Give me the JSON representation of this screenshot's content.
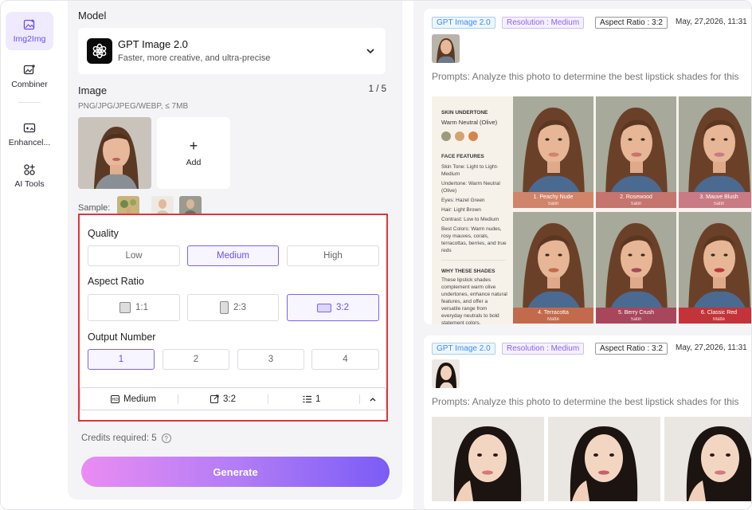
{
  "sidebar": {
    "items": [
      {
        "label": "Img2Img",
        "icon": "image-sparkle-icon",
        "active": true
      },
      {
        "label": "Combiner",
        "icon": "combine-images-icon",
        "active": false
      },
      {
        "label": "Enhancel...",
        "icon": "enhance-image-icon",
        "active": false
      },
      {
        "label": "AI Tools",
        "icon": "ai-tools-grid-icon",
        "active": false
      }
    ]
  },
  "panel": {
    "model_label": "Model",
    "model": {
      "name": "GPT Image 2.0",
      "description": "Faster, more creative, and ultra-precise",
      "icon": "openai-logo-icon"
    },
    "image_label": "Image",
    "image_count": "1 / 5",
    "image_hint": "PNG/JPG/JPEG/WEBP, ≤ 7MB",
    "add_label": "Add",
    "sample_label": "Sample:"
  },
  "settings": {
    "quality_label": "Quality",
    "quality_options": [
      "Low",
      "Medium",
      "High"
    ],
    "quality_selected": "Medium",
    "aspect_label": "Aspect Ratio",
    "aspect_options": [
      "1:1",
      "2:3",
      "3:2"
    ],
    "aspect_selected": "3:2",
    "output_label": "Output Number",
    "output_options": [
      "1",
      "2",
      "3",
      "4"
    ],
    "output_selected": "1",
    "summary": {
      "quality": "Medium",
      "aspect": "3:2",
      "output": "1"
    }
  },
  "credits_text": "Credits required: 5",
  "credits_help": "?",
  "generate_label": "Generate",
  "results": [
    {
      "model_tag": "GPT Image 2.0",
      "resolution_tag": "Resolution : Medium",
      "aspect_tag": "Aspect Ratio : 3:2",
      "date": "May, 27,2026, 11:31",
      "prompt": "Prompts: Analyze this photo to determine the best lipstick shades for this",
      "panel": {
        "skin_undertone_title": "SKIN UNDERTONE",
        "skin_undertone_value": "Warm Neutral (Olive)",
        "swatch_colors": [
          "#9a9c7a",
          "#d3a472",
          "#d7834e"
        ],
        "face_features_title": "FACE FEATURES",
        "features": [
          "Skin Tone: Light to Light-Medium",
          "Undertone: Warm Neutral (Olive)",
          "Eyes: Hazel Green",
          "Hair: Light Brown",
          "Contrast: Low to Medium",
          "Best Colors: Warm nudes, rosy mauves, corals, terracottas, berries, and true reds"
        ],
        "why_title": "WHY THESE SHADES",
        "why_text": "These lipstick shades complement warm olive undertones, enhance natural features, and offer a versatile range from everyday neutrals to bold statement colors."
      },
      "shades": [
        {
          "name": "1. Peachy Nude",
          "finish": "Satin",
          "color": "#d1846a"
        },
        {
          "name": "2. Rosewood",
          "finish": "Satin",
          "color": "#c5746e"
        },
        {
          "name": "3. Mauve Blush",
          "finish": "Satin",
          "color": "#c97a84"
        },
        {
          "name": "4. Terracotta",
          "finish": "Matte",
          "color": "#c36a4c"
        },
        {
          "name": "5. Berry Crush",
          "finish": "Satin",
          "color": "#a8465c"
        },
        {
          "name": "6. Classic Red",
          "finish": "Matte",
          "color": "#c2343a"
        }
      ]
    },
    {
      "model_tag": "GPT Image 2.0",
      "resolution_tag": "Resolution : Medium",
      "aspect_tag": "Aspect Ratio : 3:2",
      "date": "May, 27,2026, 11:31",
      "prompt": "Prompts: Analyze this photo to determine the best lipstick shades for this"
    }
  ]
}
